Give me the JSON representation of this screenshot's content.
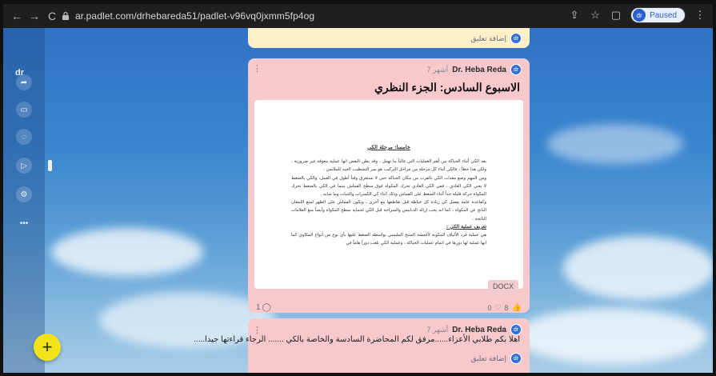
{
  "browser": {
    "url": "ar.padlet.com/drhebareda51/padlet-v96vq0jxmm5fp4og",
    "profile_label": "Paused",
    "profile_initials": "dr"
  },
  "rail": {
    "initials": "dr",
    "items": [
      "share-icon",
      "window-icon",
      "bell-icon",
      "play-icon",
      "gear-icon",
      "more-icon"
    ]
  },
  "top_card": {
    "add_comment": "إضافة تعليق",
    "avatar": "dr"
  },
  "post": {
    "author": "Dr. Heba Reda",
    "time": "7 أشهر",
    "avatar": "dr",
    "title": "الاسبوع السادس: الجزء النظري",
    "doc_heading": "خامسا: مرحلة الكي",
    "doc_paragraphs": [
      "يعد الكي أثناء الحياكة من أهم العمليات التي غالباً ما تهمل ، وقد يظن البعض انها عملية معوقة غير ضرورية ، ولكن هذا خطأ ، فالكي أثناء كل مرحلة من مراحل التركيب هو سر التشطيب الجيد للملابس .",
      "ومن المهم وضع معدات الكي بالقرب من مكان الحياكة حتى لا تستغرق وقتاً أطول في العمل، والكي بالضغط لا يعني الكي العادي ، ففي الكي العادي تحرك المكواة فوق سطح القماش بينما في الكي بالضغط تحرك المكواة حركة قليلة جداً أثناء الضغط على القماش وذلك اثناء كي الكسرات والثنيات وما شابه .",
      "وكقاعدة عامة يفصل كي زيادة كل خياطة قبل تقاطعها مع أخرى ، ويكون القماش على الظهر لمنع اللمعان الناتج عن المكواة ، كما انه يجب إزالة الدبابيس والسراجة قبل الكي لحماية سطح المكواة وأيضاً منع العلامات الناتجة ."
    ],
    "doc_subheading": "تعريف عملية الكي :",
    "doc_last": "هي عملية فرد الألياف المكونة لأقمشة المنتج الملبسي بواسطة الضغط عليها بأي نوع من أنواع المكاوي كما انها عملية لها دورها في اتمام عمليات الحياكة ، وعملية الكي تلعب دوراً هاماً في",
    "file_type": "DOCX",
    "comments_count": "1",
    "reaction_left": "0",
    "likes": "8"
  },
  "bottom_card": {
    "author": "Dr. Heba Reda",
    "time": "7 أشهر",
    "avatar": "dr",
    "text": "اهلا بكم طلابي الأعزاء......مرفق لكم المحاضرة السادسة والخاصة بالكي ....... الرجاء قراءتها جيدا.....",
    "add_comment": "إضافة تعليق"
  },
  "fab": {
    "label": "+"
  }
}
